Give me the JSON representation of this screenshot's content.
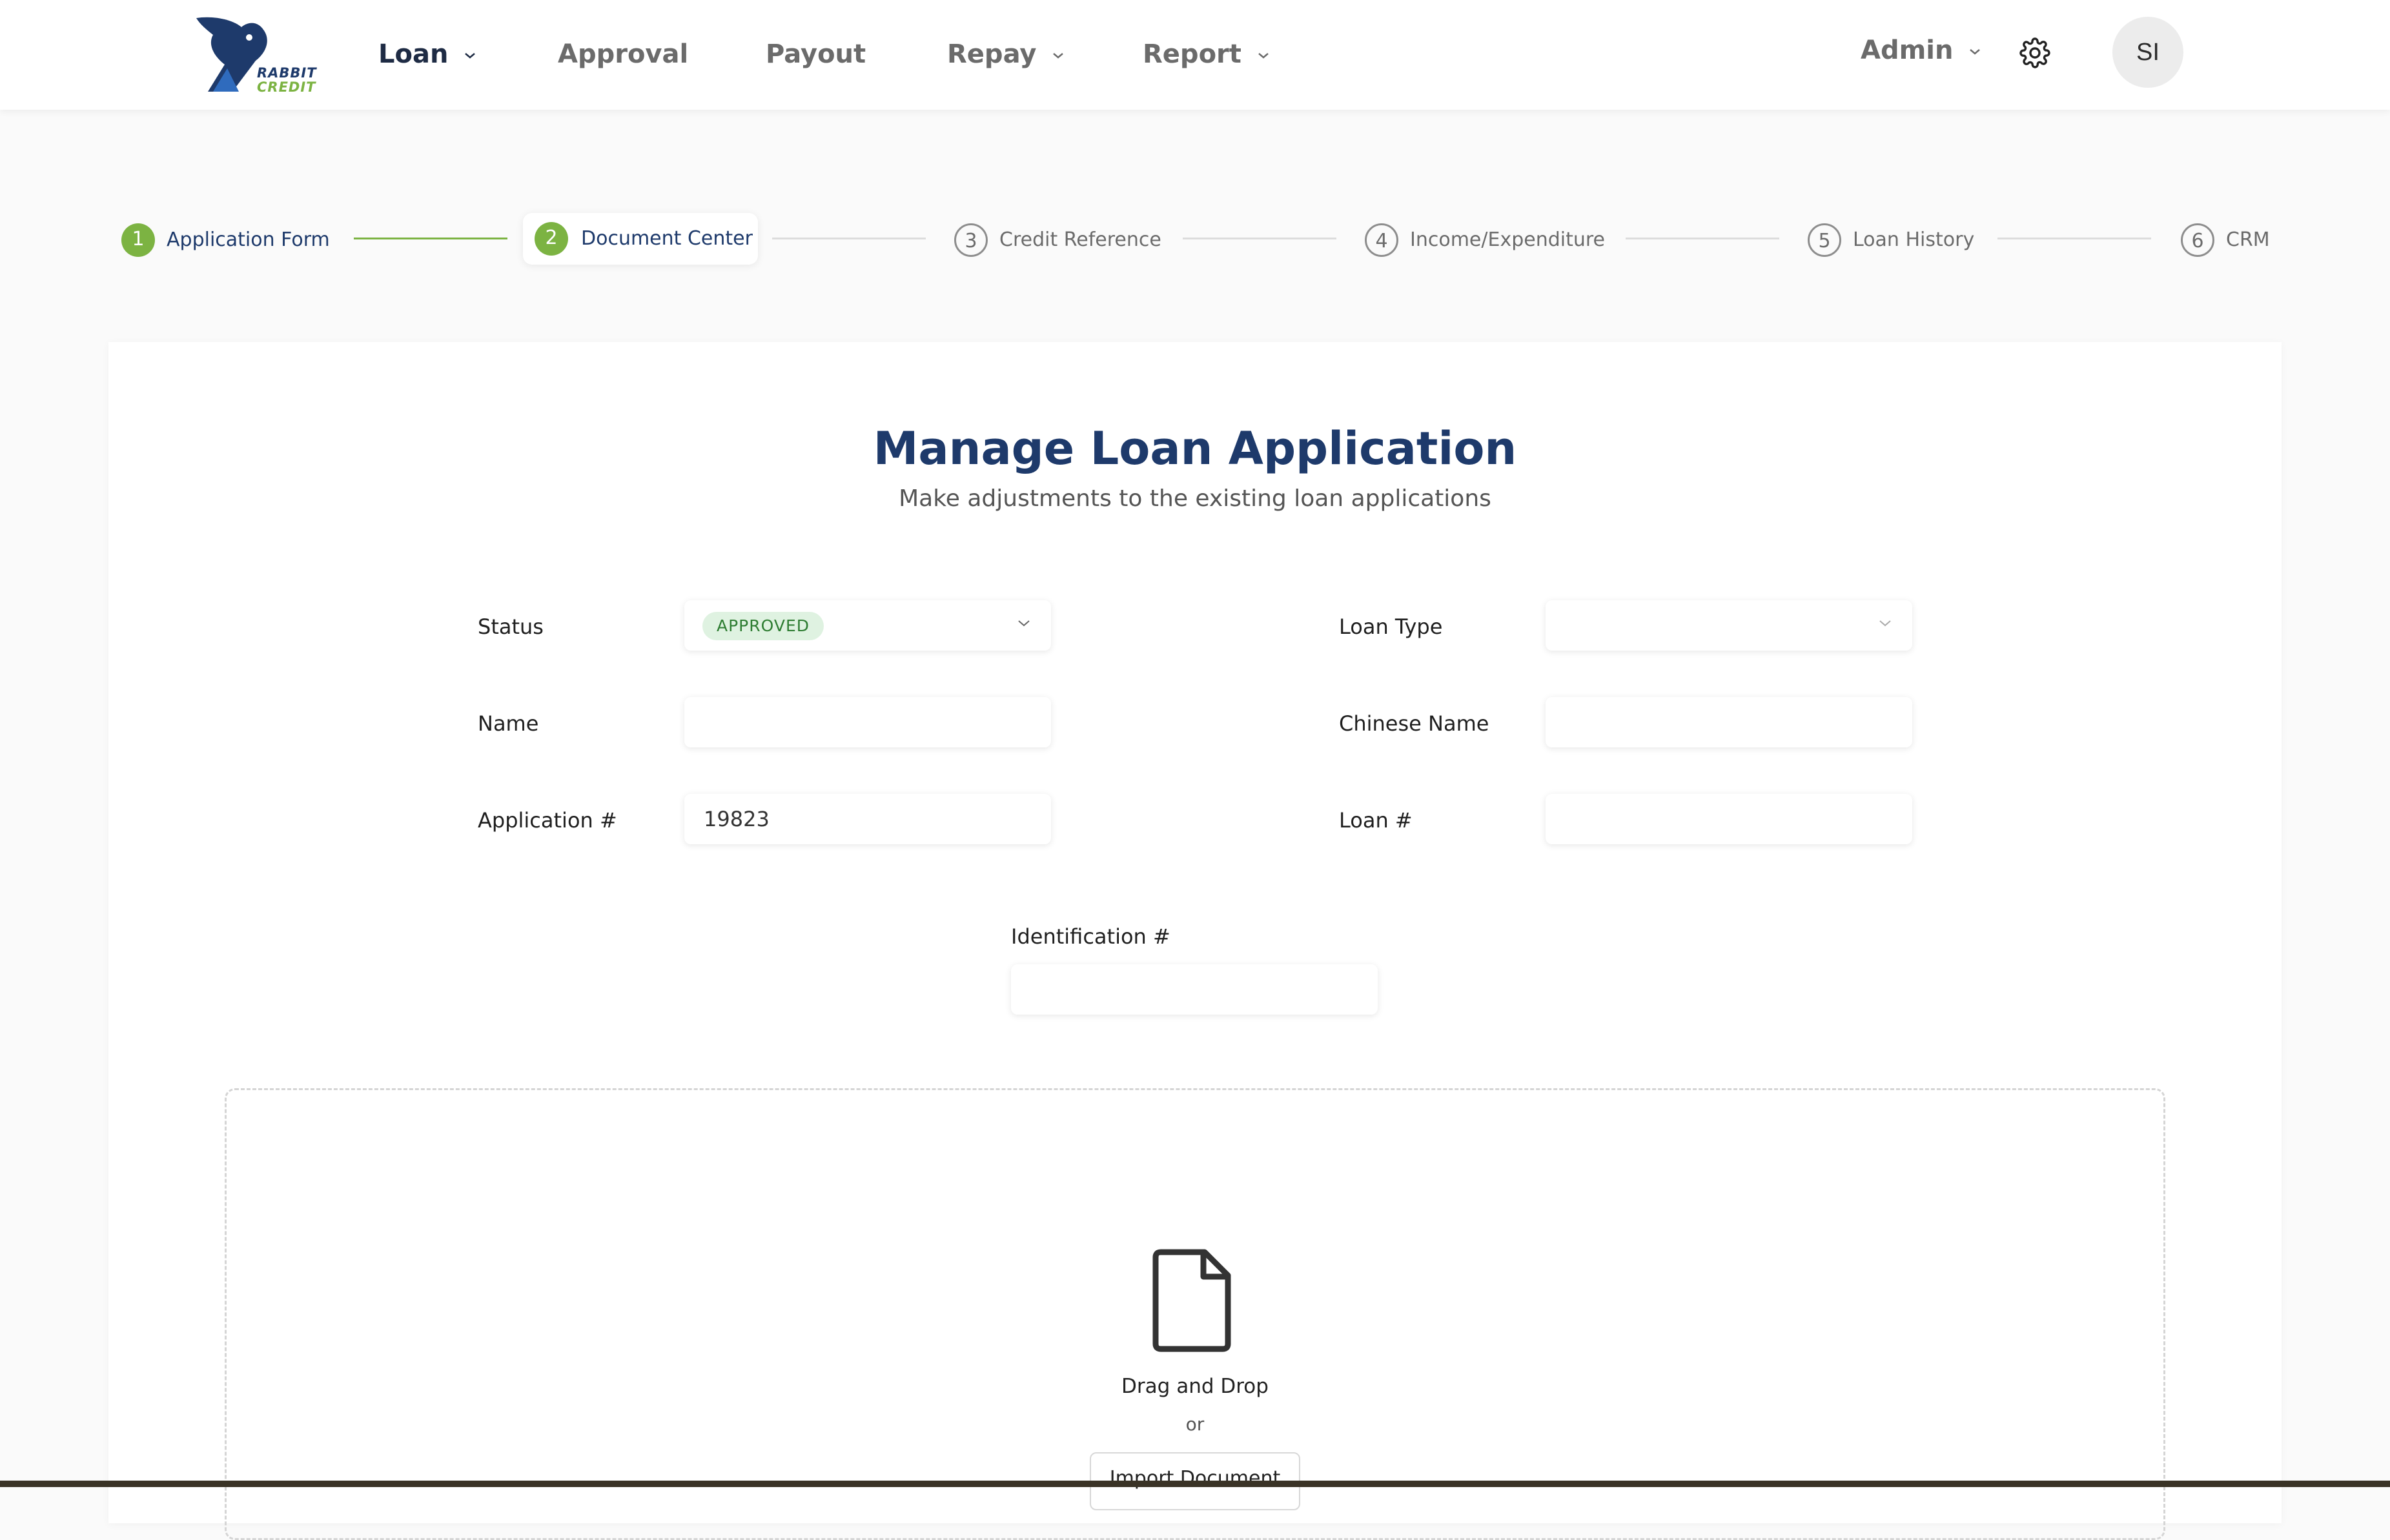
{
  "brand": {
    "logo_line1": "RABBIT",
    "logo_line2": "CREDIT",
    "brand_color": "#1e3a6b",
    "accent_color": "#7cb342"
  },
  "nav": {
    "items": [
      {
        "label": "Loan",
        "active": true,
        "has_dropdown": true
      },
      {
        "label": "Approval",
        "active": false,
        "has_dropdown": false
      },
      {
        "label": "Payout",
        "active": false,
        "has_dropdown": false
      },
      {
        "label": "Repay",
        "active": false,
        "has_dropdown": true
      },
      {
        "label": "Report",
        "active": false,
        "has_dropdown": true
      }
    ],
    "admin_label": "Admin",
    "settings_icon": "gear-icon",
    "avatar_initials": "SI"
  },
  "stepper": {
    "steps": [
      {
        "number": "1",
        "label": "Application Form",
        "state": "done"
      },
      {
        "number": "2",
        "label": "Document Center",
        "state": "current"
      },
      {
        "number": "3",
        "label": "Credit Reference",
        "state": "todo"
      },
      {
        "number": "4",
        "label": "Income/Expenditure",
        "state": "todo"
      },
      {
        "number": "5",
        "label": "Loan History",
        "state": "todo"
      },
      {
        "number": "6",
        "label": "CRM",
        "state": "todo"
      }
    ]
  },
  "form": {
    "title": "Manage Loan Application",
    "subtitle": "Make adjustments to the existing loan applications",
    "status": {
      "label": "Status",
      "value": "APPROVED",
      "badge_color": "#dff2e1"
    },
    "loan_type": {
      "label": "Loan Type",
      "value": ""
    },
    "name": {
      "label": "Name",
      "value": ""
    },
    "chinese_name": {
      "label": "Chinese Name",
      "value": ""
    },
    "application_no": {
      "label": "Application #",
      "value": "19823"
    },
    "loan_no": {
      "label": "Loan #",
      "value": ""
    },
    "identification_no": {
      "label": "Identification #",
      "value": ""
    }
  },
  "upload": {
    "icon": "file-icon",
    "drag_text": "Drag and Drop",
    "or_text": "or",
    "button_label": "Import Document"
  }
}
